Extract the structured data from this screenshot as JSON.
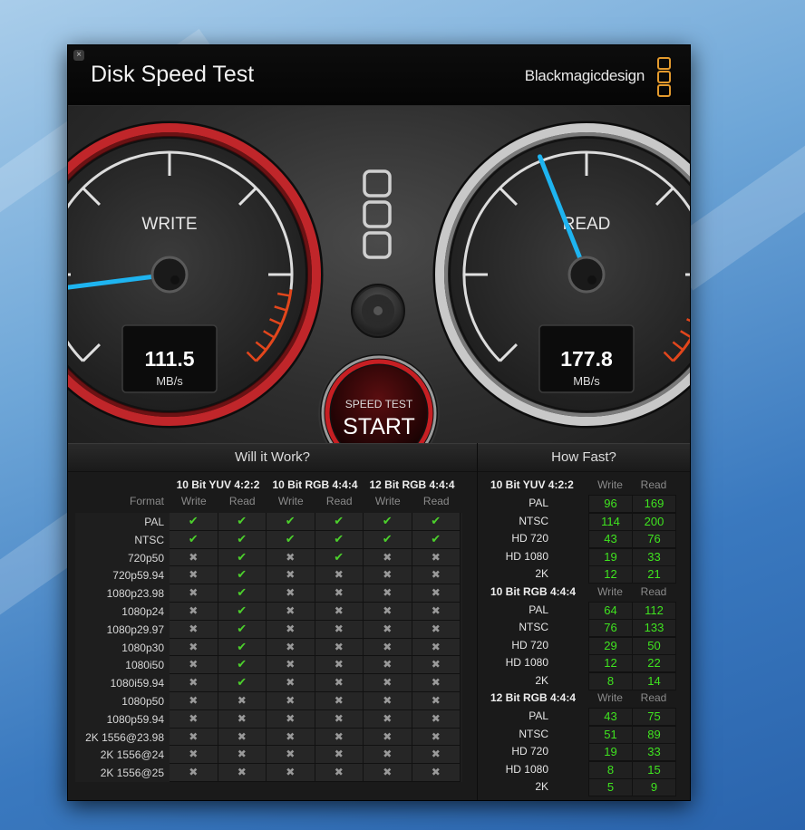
{
  "window": {
    "close_icon": "close-icon",
    "title": "Disk Speed Test",
    "brand": "Blackmagicdesign",
    "brand_logo": "blackmagic-logo"
  },
  "gauges": {
    "write": {
      "label": "WRITE",
      "value": "111.5",
      "unit": "MB/s",
      "needle_fraction": 0.14,
      "ring_color": "#c0262a"
    },
    "read": {
      "label": "READ",
      "value": "177.8",
      "unit": "MB/s",
      "needle_fraction": 0.42,
      "ring_color": "#c8c8c8"
    },
    "needle_color": "#1eb4f0"
  },
  "start_button": {
    "line1": "SPEED TEST",
    "line2": "START"
  },
  "settings_icon": "gear-icon",
  "will_it_work": {
    "title": "Will it Work?",
    "groups": [
      "10 Bit YUV 4:2:2",
      "10 Bit RGB 4:4:4",
      "12 Bit RGB 4:4:4"
    ],
    "format_label": "Format",
    "col_labels": [
      "Write",
      "Read",
      "Write",
      "Read",
      "Write",
      "Read"
    ],
    "symbols": {
      "ok": "✔",
      "no": "✖"
    },
    "rows": [
      {
        "format": "PAL",
        "results": [
          1,
          1,
          1,
          1,
          1,
          1
        ]
      },
      {
        "format": "NTSC",
        "results": [
          1,
          1,
          1,
          1,
          1,
          1
        ]
      },
      {
        "format": "720p50",
        "results": [
          0,
          1,
          0,
          1,
          0,
          0
        ]
      },
      {
        "format": "720p59.94",
        "results": [
          0,
          1,
          0,
          0,
          0,
          0
        ]
      },
      {
        "format": "1080p23.98",
        "results": [
          0,
          1,
          0,
          0,
          0,
          0
        ]
      },
      {
        "format": "1080p24",
        "results": [
          0,
          1,
          0,
          0,
          0,
          0
        ]
      },
      {
        "format": "1080p29.97",
        "results": [
          0,
          1,
          0,
          0,
          0,
          0
        ]
      },
      {
        "format": "1080p30",
        "results": [
          0,
          1,
          0,
          0,
          0,
          0
        ]
      },
      {
        "format": "1080i50",
        "results": [
          0,
          1,
          0,
          0,
          0,
          0
        ]
      },
      {
        "format": "1080i59.94",
        "results": [
          0,
          1,
          0,
          0,
          0,
          0
        ]
      },
      {
        "format": "1080p50",
        "results": [
          0,
          0,
          0,
          0,
          0,
          0
        ]
      },
      {
        "format": "1080p59.94",
        "results": [
          0,
          0,
          0,
          0,
          0,
          0
        ]
      },
      {
        "format": "2K 1556@23.98",
        "results": [
          0,
          0,
          0,
          0,
          0,
          0
        ]
      },
      {
        "format": "2K 1556@24",
        "results": [
          0,
          0,
          0,
          0,
          0,
          0
        ]
      },
      {
        "format": "2K 1556@25",
        "results": [
          0,
          0,
          0,
          0,
          0,
          0
        ]
      }
    ]
  },
  "how_fast": {
    "title": "How Fast?",
    "col_labels": [
      "Write",
      "Read"
    ],
    "sections": [
      {
        "title": "10 Bit YUV 4:2:2",
        "rows": [
          {
            "format": "PAL",
            "write": "96",
            "read": "169"
          },
          {
            "format": "NTSC",
            "write": "114",
            "read": "200"
          },
          {
            "format": "HD 720",
            "write": "43",
            "read": "76"
          },
          {
            "format": "HD 1080",
            "write": "19",
            "read": "33"
          },
          {
            "format": "2K",
            "write": "12",
            "read": "21"
          }
        ]
      },
      {
        "title": "10 Bit RGB 4:4:4",
        "rows": [
          {
            "format": "PAL",
            "write": "64",
            "read": "112"
          },
          {
            "format": "NTSC",
            "write": "76",
            "read": "133"
          },
          {
            "format": "HD 720",
            "write": "29",
            "read": "50"
          },
          {
            "format": "HD 1080",
            "write": "12",
            "read": "22"
          },
          {
            "format": "2K",
            "write": "8",
            "read": "14"
          }
        ]
      },
      {
        "title": "12 Bit RGB 4:4:4",
        "rows": [
          {
            "format": "PAL",
            "write": "43",
            "read": "75"
          },
          {
            "format": "NTSC",
            "write": "51",
            "read": "89"
          },
          {
            "format": "HD 720",
            "write": "19",
            "read": "33"
          },
          {
            "format": "HD 1080",
            "write": "8",
            "read": "15"
          },
          {
            "format": "2K",
            "write": "5",
            "read": "9"
          }
        ]
      }
    ]
  }
}
